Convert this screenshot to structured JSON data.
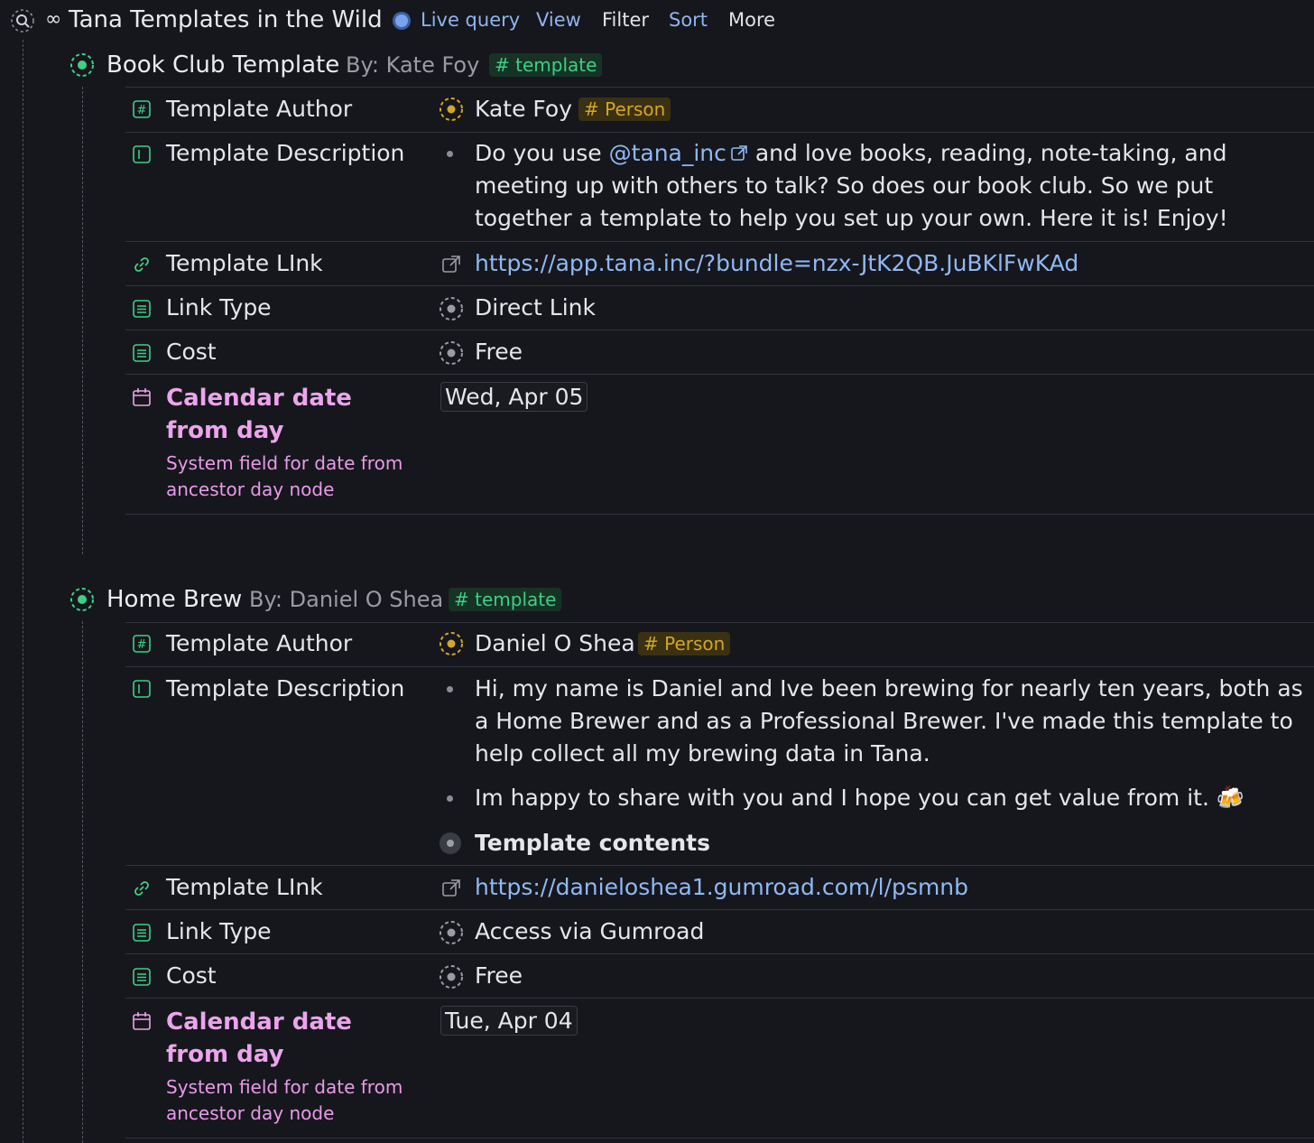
{
  "header": {
    "title": "Tana Templates in the Wild",
    "live_query": "Live query",
    "view": "View",
    "filter": "Filter",
    "sort": "Sort",
    "more": "More"
  },
  "entries": [
    {
      "title": "Book Club Template",
      "by": "By: Kate Foy",
      "tag": "# template",
      "author_label": "Template Author",
      "author": "Kate Foy",
      "author_tag": "# Person",
      "desc_label": "Template Description",
      "desc_pre": "Do you use",
      "desc_mention": "@tana_inc",
      "desc_post": "and love books, reading, note-taking, and meeting up with others to talk? So does our book club. So we put together a template to help you set up your own. Here it is! Enjoy!",
      "link_label": "Template LInk",
      "link": "https://app.tana.inc/?bundle=nzx-JtK2QB.JuBKlFwKAd",
      "link_type_label": "Link Type",
      "link_type": "Direct Link",
      "cost_label": "Cost",
      "cost": "Free",
      "cal_label": "Calendar date from day",
      "cal_sub": "System field for date from ancestor day node",
      "date": "Wed, Apr 05"
    },
    {
      "title": "Home Brew",
      "by": "By: Daniel O Shea",
      "tag": "# template",
      "author_label": "Template Author",
      "author": "Daniel O Shea",
      "author_tag": "# Person",
      "desc_label": "Template Description",
      "desc_1": "Hi, my name is Daniel and Ive been brewing for nearly ten years, both as a Home Brewer and as a Professional Brewer. I've made this template to help collect all my brewing data in Tana.",
      "desc_2": "Im happy to share with you and I hope you can get value from it. 🍻",
      "desc_3": "Template contents",
      "link_label": "Template LInk",
      "link": "https://danieloshea1.gumroad.com/l/psmnb",
      "link_type_label": "Link Type",
      "link_type": "Access via Gumroad",
      "cost_label": "Cost",
      "cost": "Free",
      "cal_label": "Calendar date from day",
      "cal_sub": "System field for date from ancestor day node",
      "date": "Tue, Apr 04"
    }
  ],
  "colors": {
    "background": "#16171c",
    "accent_blue": "#8fb4f0",
    "tag_green": "#3fcf86",
    "tag_yellow": "#d5a529",
    "system_field_pink": "#eca4ec"
  }
}
